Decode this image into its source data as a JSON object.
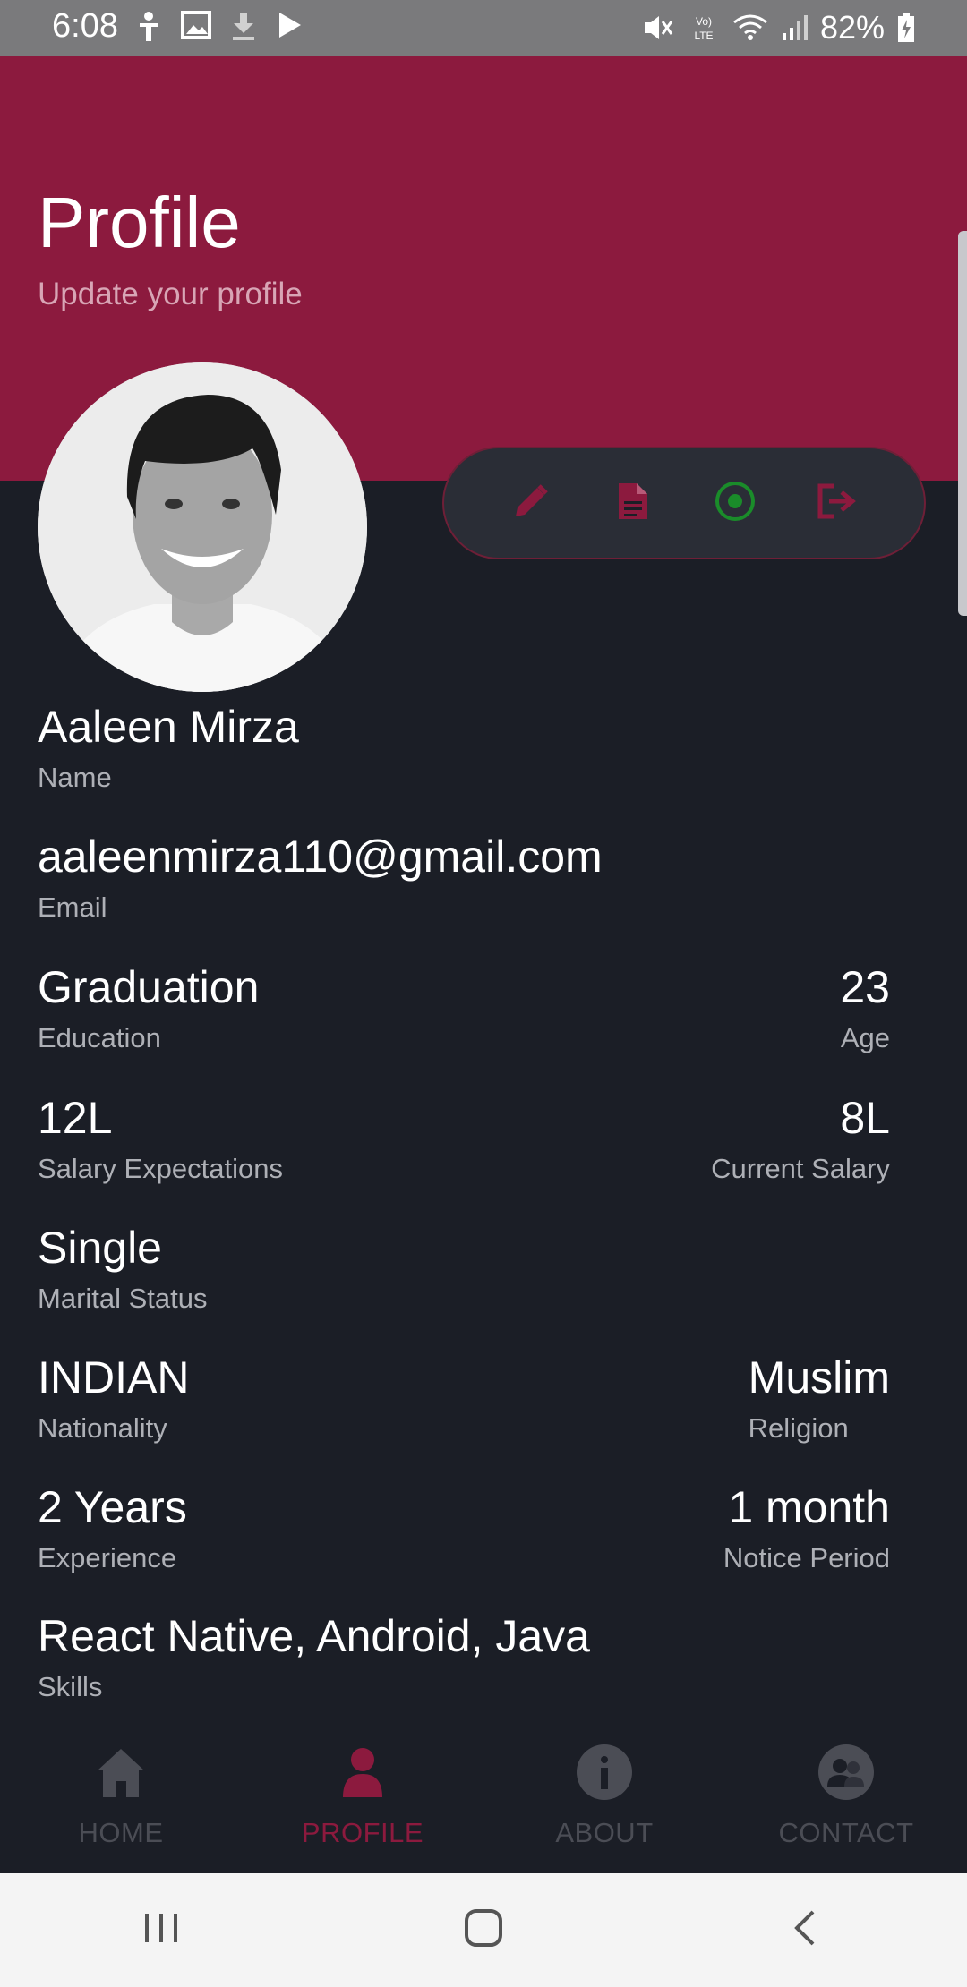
{
  "status_bar": {
    "time": "6:08",
    "battery_percent": "82%",
    "left_icons": [
      "accessibility-icon",
      "image-icon",
      "download-icon",
      "play-store-icon"
    ],
    "right_icons": [
      "mute-icon",
      "volte-icon",
      "wifi-icon",
      "signal-icon",
      "battery-charging-icon"
    ]
  },
  "header": {
    "title": "Profile",
    "subtitle": "Update your profile",
    "color": "#8c1a3e"
  },
  "actions": [
    {
      "icon": "pencil-icon",
      "color": "#8c1a3e"
    },
    {
      "icon": "document-icon",
      "color": "#8c1a3e"
    },
    {
      "icon": "radio-dot-icon",
      "color": "#1a8c2a"
    },
    {
      "icon": "logout-icon",
      "color": "#8c1a3e"
    }
  ],
  "profile": {
    "name": {
      "value": "Aaleen Mirza",
      "label": "Name"
    },
    "email": {
      "value": "aaleenmirza110@gmail.com",
      "label": "Email"
    },
    "education": {
      "value": "Graduation",
      "label": "Education"
    },
    "age": {
      "value": "23",
      "label": "Age"
    },
    "salary_expectations": {
      "value": "12L",
      "label": "Salary Expectations"
    },
    "current_salary": {
      "value": "8L",
      "label": "Current Salary"
    },
    "marital_status": {
      "value": "Single",
      "label": "Marital Status"
    },
    "nationality": {
      "value": "INDIAN",
      "label": "Nationality"
    },
    "religion": {
      "value": "Muslim",
      "label": "Religion"
    },
    "experience": {
      "value": "2 Years",
      "label": "Experience"
    },
    "notice_period": {
      "value": "1 month",
      "label": "Notice Period"
    },
    "skills": {
      "value": "React Native, Android, Java",
      "label": "Skills"
    }
  },
  "bottom_nav": [
    {
      "label": "HOME",
      "icon": "home-icon",
      "active": false
    },
    {
      "label": "PROFILE",
      "icon": "person-icon",
      "active": true
    },
    {
      "label": "ABOUT",
      "icon": "info-icon",
      "active": false
    },
    {
      "label": "CONTACT",
      "icon": "contacts-icon",
      "active": false
    }
  ],
  "system_nav": [
    "recents-icon",
    "home-button-icon",
    "back-icon"
  ]
}
